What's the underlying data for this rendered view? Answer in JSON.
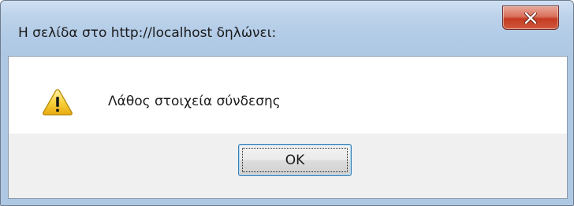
{
  "dialog": {
    "title": "Η σελίδα στο http://localhost δηλώνει:",
    "message": "Λάθος στοιχεία σύνδεσης",
    "ok_label": "OK",
    "icon": "warning-icon"
  },
  "colors": {
    "close_button": "#c94a33",
    "frame": "#b9d1ea",
    "ok_border": "#3c7fb1"
  }
}
